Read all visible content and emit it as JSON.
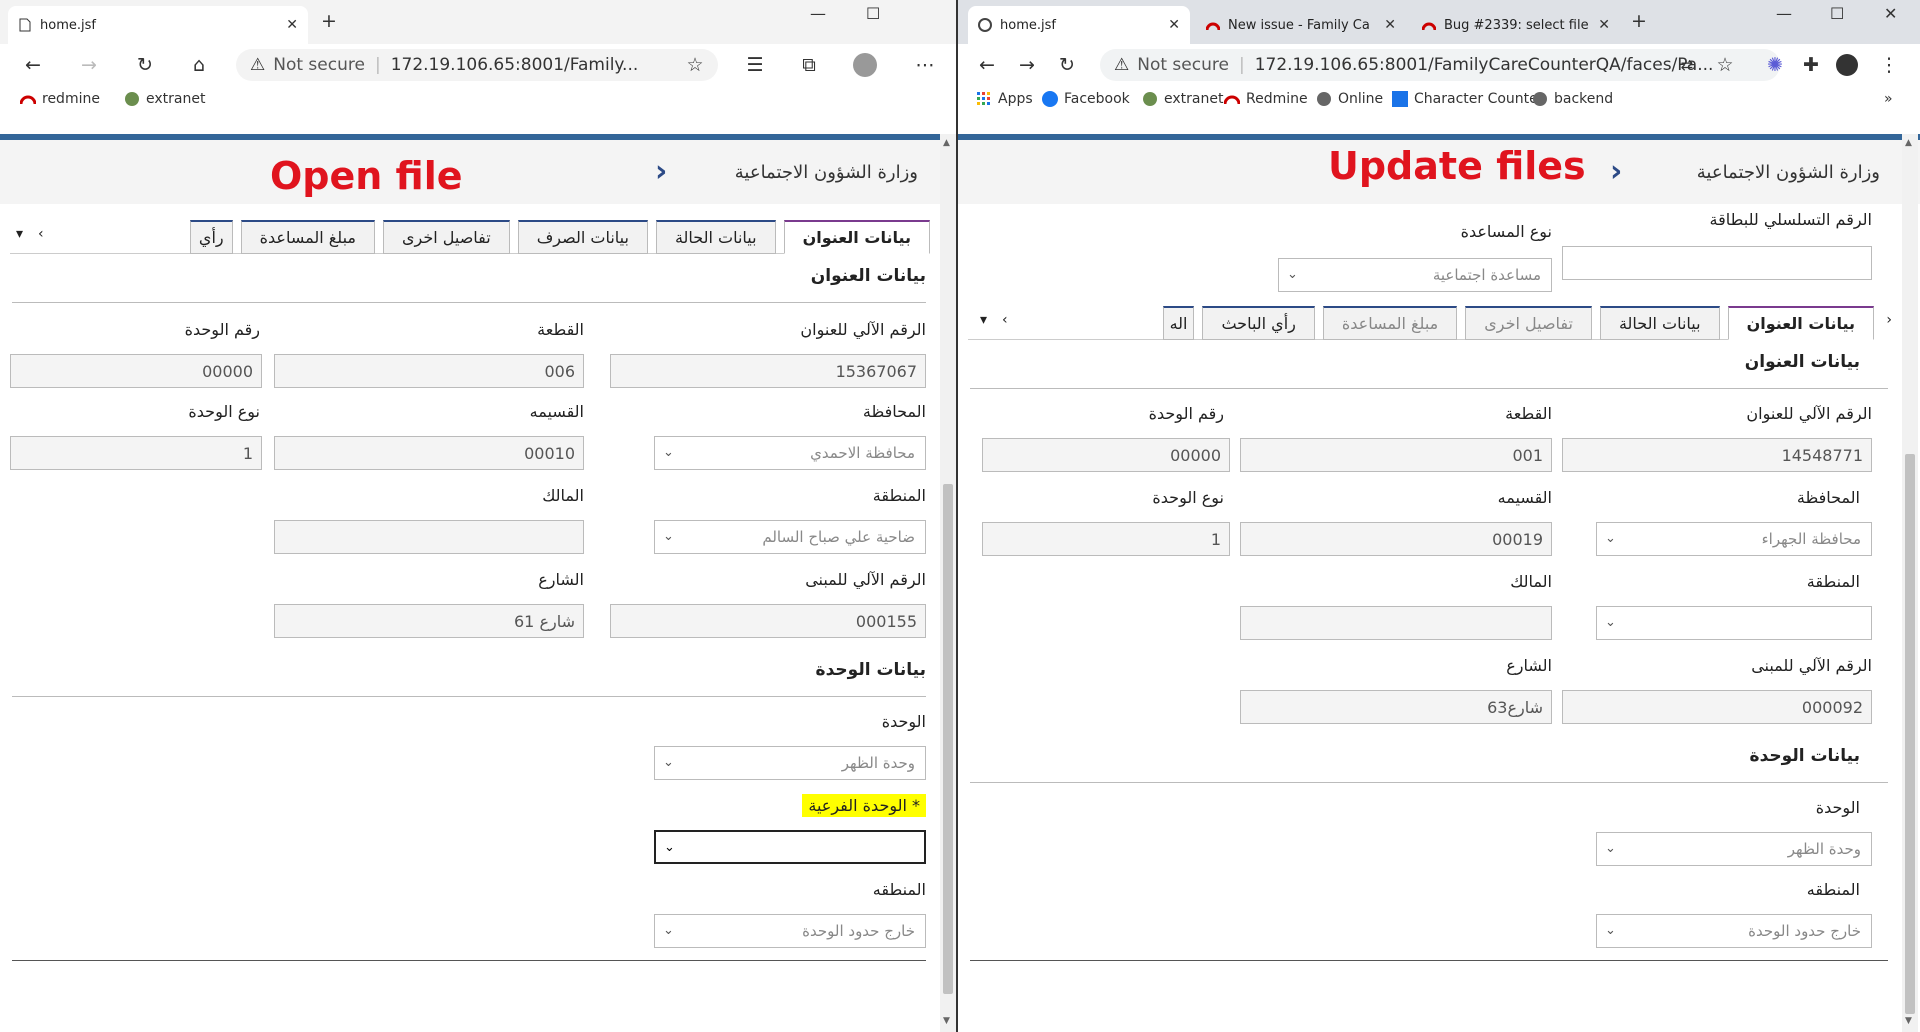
{
  "left": {
    "tab_title": "home.jsf",
    "window": {
      "minimize": "—",
      "maximize": "☐"
    },
    "url": {
      "warning": "Not secure",
      "address": "172.19.106.65:8001/Family..."
    },
    "bookmarks": [
      {
        "label": "redmine"
      },
      {
        "label": "extranet"
      }
    ],
    "ministry": "وزارة الشؤون الاجتماعية",
    "annotation": "Open file",
    "tabs": [
      {
        "label": "بيانات العنوان"
      },
      {
        "label": "بيانات الحالة"
      },
      {
        "label": "بيانات الصرف"
      },
      {
        "label": "تفاصيل اخرى"
      },
      {
        "label": "مبلغ المساعدة"
      },
      {
        "label": "رأي"
      }
    ],
    "address_section": "بيانات العنوان",
    "fields": {
      "auto_address_label": "الرقم الآلي للعنوان",
      "auto_address_value": "15367067",
      "block_label": "القطعة",
      "block_value": "006",
      "unit_no_label": "رقم الوحدة",
      "unit_no_value": "00000",
      "governorate_label": "المحافظة",
      "governorate_value": "محافظة الاحمدي",
      "plot_label": "القسيمه",
      "plot_value": "00010",
      "unit_type_label": "نوع الوحدة",
      "unit_type_value": "1",
      "area_label": "المنطقة",
      "area_value": "ضاحية علي صباح السالم",
      "owner_label": "المالك",
      "owner_value": "",
      "building_label": "الرقم الآلي للمبنى",
      "building_value": "000155",
      "street_label": "الشارع",
      "street_value": "شارع 61"
    },
    "unit_section": "بيانات الوحدة",
    "unit": {
      "unit_label": "الوحدة",
      "unit_value": "وحدة الظهر",
      "subunit_label": "* الوحدة الفرعية",
      "subunit_value": "",
      "region_label": "المنطقه",
      "region_value": "خارج حدود الوحدة"
    }
  },
  "right": {
    "tabs_browser": [
      {
        "label": "home.jsf"
      },
      {
        "label": "New issue - Family Ca"
      },
      {
        "label": "Bug #2339: select file"
      }
    ],
    "window": {
      "minimize": "—",
      "maximize": "☐",
      "close": "✕"
    },
    "url": {
      "warning": "Not secure",
      "address": "172.19.106.65:8001/FamilyCareCounterQA/faces/Pa..."
    },
    "bookmarks": [
      {
        "label": "Apps"
      },
      {
        "label": "Facebook"
      },
      {
        "label": "extranet"
      },
      {
        "label": "Redmine"
      },
      {
        "label": "Online"
      },
      {
        "label": "Character Counter"
      },
      {
        "label": "backend"
      }
    ],
    "more_bookmarks": "»",
    "ministry": "وزارة الشؤون الاجتماعية",
    "annotation": "Update files",
    "card_serial_label": "الرقم التسلسلي للبطاقة",
    "card_serial_value": "",
    "aid_type_label": "نوع المساعدة",
    "aid_type_value": "مساعدة اجتماعية",
    "tabs": [
      {
        "label": "بيانات العنوان"
      },
      {
        "label": "بيانات الحالة"
      },
      {
        "label": "تفاصيل اخرى"
      },
      {
        "label": "مبلغ المساعدة"
      },
      {
        "label": "رأي الباحث"
      },
      {
        "label": "اله"
      }
    ],
    "address_section": "بيانات العنوان",
    "fields": {
      "auto_address_label": "الرقم الآلي للعنوان",
      "auto_address_value": "14548771",
      "block_label": "القطعة",
      "block_value": "001",
      "unit_no_label": "رقم الوحدة",
      "unit_no_value": "00000",
      "governorate_label": "المحافظة",
      "governorate_value": "محافظة الجهراء",
      "plot_label": "القسيمه",
      "plot_value": "00019",
      "unit_type_label": "نوع الوحدة",
      "unit_type_value": "1",
      "area_label": "المنطقة",
      "area_value": "",
      "owner_label": "المالك",
      "owner_value": "",
      "building_label": "الرقم الآلي للمبنى",
      "building_value": "000092",
      "street_label": "الشارع",
      "street_value": "شارع63"
    },
    "unit_section": "بيانات الوحدة",
    "unit": {
      "unit_label": "الوحدة",
      "unit_value": "وحدة الظهر",
      "region_label": "المنطقه",
      "region_value": "خارج حدود الوحدة"
    }
  },
  "colors": {
    "accent": "#2c4a86",
    "annotation": "#e0141e",
    "highlight": "#ffff00",
    "edge_frame": "#f3f3f3",
    "chrome_frame": "#dee1e6"
  }
}
